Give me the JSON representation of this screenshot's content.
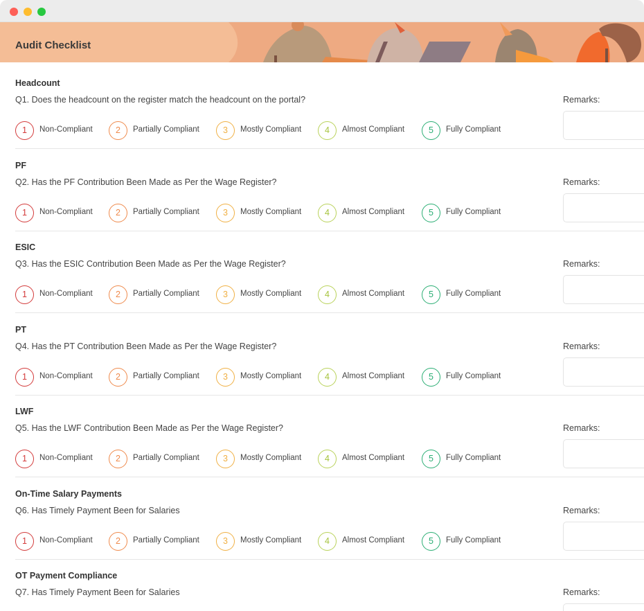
{
  "page": {
    "title": "Audit Checklist"
  },
  "remarks_label": "Remarks:",
  "options": [
    {
      "num": "1",
      "label": "Non-Compliant"
    },
    {
      "num": "2",
      "label": "Partially Compliant"
    },
    {
      "num": "3",
      "label": "Mostly Compliant"
    },
    {
      "num": "4",
      "label": "Almost Compliant"
    },
    {
      "num": "5",
      "label": "Fully Compliant"
    }
  ],
  "sections": [
    {
      "title": "Headcount",
      "question": "Q1. Does the headcount on the register match the headcount on the portal?"
    },
    {
      "title": "PF",
      "question": "Q2. Has the PF Contribution Been Made as Per the Wage Register?"
    },
    {
      "title": "ESIC",
      "question": "Q3. Has the ESIC Contribution Been Made as Per the Wage Register?"
    },
    {
      "title": "PT",
      "question": "Q4. Has the PT Contribution Been Made as Per the Wage Register?"
    },
    {
      "title": "LWF",
      "question": "Q5. Has the LWF Contribution Been Made as Per the Wage Register?"
    },
    {
      "title": "On-Time Salary Payments",
      "question": "Q6. Has Timely Payment Been for Salaries"
    },
    {
      "title": "OT Payment Compliance",
      "question": "Q7. Has Timely Payment Been for Salaries"
    }
  ],
  "colors": {
    "banner": "#f4bd96",
    "non_compliant": "#d33a3a",
    "partially_compliant": "#ef8a4c",
    "mostly_compliant": "#f0b044",
    "almost_compliant": "#b9d25a",
    "fully_compliant": "#2bae74"
  }
}
